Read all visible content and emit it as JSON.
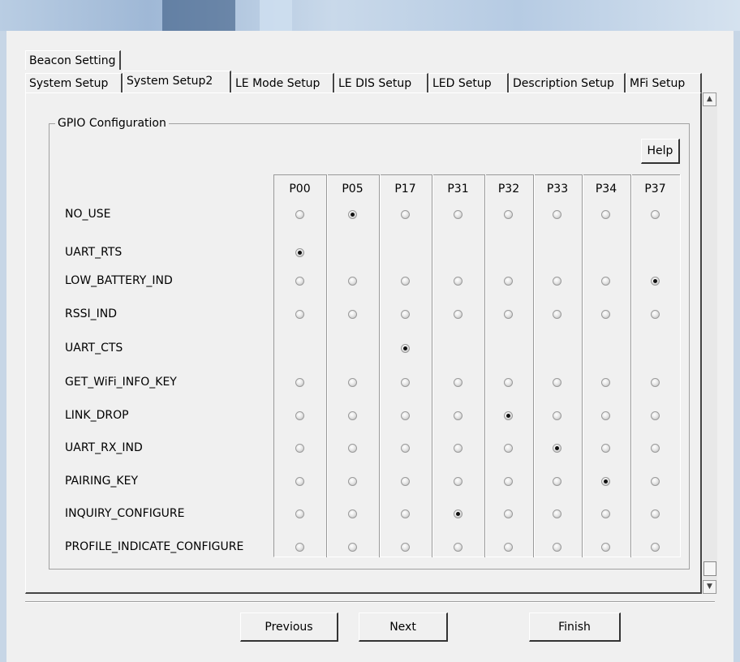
{
  "tabs": {
    "row1": [
      "Beacon Setting"
    ],
    "row2": [
      "System Setup",
      "System Setup2",
      "LE Mode Setup",
      "LE DIS Setup",
      "LED Setup",
      "Description Setup",
      "MFi Setup"
    ],
    "active": "System Setup2"
  },
  "group_title": "GPIO Configuration",
  "help_label": "Help",
  "columns": [
    "P00",
    "P05",
    "P17",
    "P31",
    "P32",
    "P33",
    "P34",
    "P37"
  ],
  "rows": [
    {
      "label": "NO_USE",
      "options": [
        "P00",
        "P05",
        "P17",
        "P31",
        "P32",
        "P33",
        "P34",
        "P37"
      ],
      "selected": "P05"
    },
    {
      "label": "UART_RTS",
      "options": [
        "P00"
      ],
      "selected": "P00"
    },
    {
      "label": "LOW_BATTERY_IND",
      "options": [
        "P00",
        "P05",
        "P17",
        "P31",
        "P32",
        "P33",
        "P34",
        "P37"
      ],
      "selected": "P37"
    },
    {
      "label": "RSSI_IND",
      "options": [
        "P00",
        "P05",
        "P17",
        "P31",
        "P32",
        "P33",
        "P34",
        "P37"
      ],
      "selected": ""
    },
    {
      "label": "UART_CTS",
      "options": [
        "P17"
      ],
      "selected": "P17"
    },
    {
      "label": "GET_WiFi_INFO_KEY",
      "options": [
        "P00",
        "P05",
        "P17",
        "P31",
        "P32",
        "P33",
        "P34",
        "P37"
      ],
      "selected": ""
    },
    {
      "label": "LINK_DROP",
      "options": [
        "P00",
        "P05",
        "P17",
        "P31",
        "P32",
        "P33",
        "P34",
        "P37"
      ],
      "selected": "P32"
    },
    {
      "label": "UART_RX_IND",
      "options": [
        "P00",
        "P05",
        "P17",
        "P31",
        "P32",
        "P33",
        "P34",
        "P37"
      ],
      "selected": "P33"
    },
    {
      "label": "PAIRING_KEY",
      "options": [
        "P00",
        "P05",
        "P17",
        "P31",
        "P32",
        "P33",
        "P34",
        "P37"
      ],
      "selected": "P34"
    },
    {
      "label": "INQUIRY_CONFIGURE",
      "options": [
        "P00",
        "P05",
        "P17",
        "P31",
        "P32",
        "P33",
        "P34",
        "P37"
      ],
      "selected": "P31"
    },
    {
      "label": "PROFILE_INDICATE_CONFIGURE",
      "options": [
        "P00",
        "P05",
        "P17",
        "P31",
        "P32",
        "P33",
        "P34",
        "P37"
      ],
      "selected": ""
    }
  ],
  "buttons": {
    "previous": "Previous",
    "next": "Next",
    "finish": "Finish"
  },
  "scrollbar": {
    "up_icon": "scroll-up-arrow-icon",
    "down_icon": "scroll-down-arrow-icon",
    "position": 0.97
  }
}
